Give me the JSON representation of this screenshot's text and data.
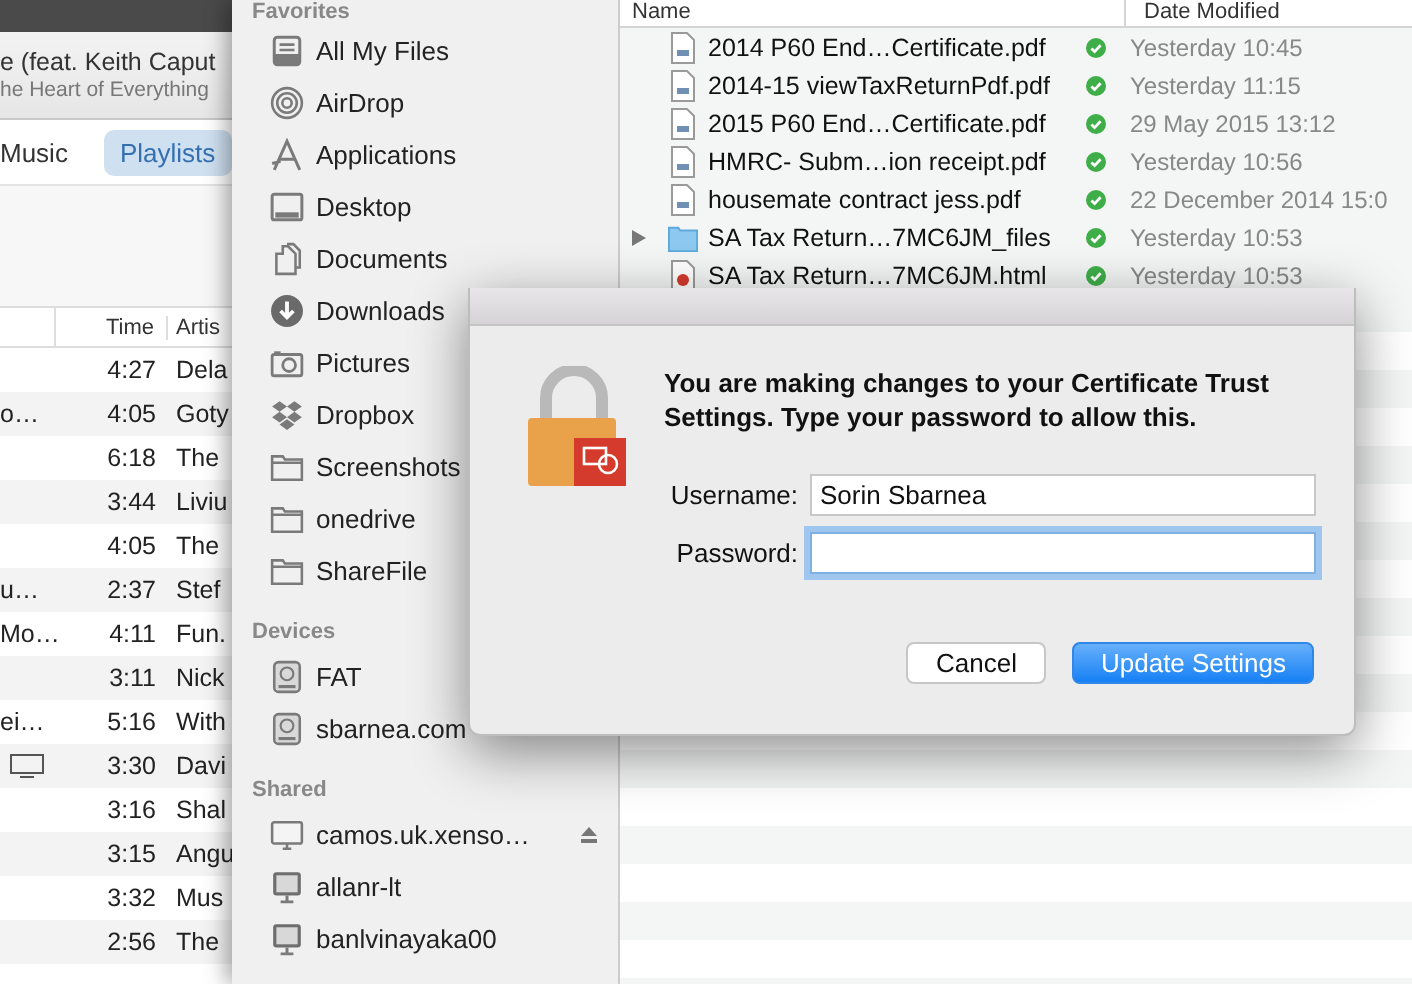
{
  "itunes": {
    "now_playing": {
      "title": "e (feat. Keith Caput",
      "album": "he Heart of Everything"
    },
    "tabs": [
      {
        "label": "Music",
        "selected": false
      },
      {
        "label": "Playlists",
        "selected": true
      }
    ],
    "columns": {
      "time": "Time",
      "artist": "Artis"
    },
    "rows": [
      {
        "kind": "song",
        "time": "4:27",
        "artist": "Dela"
      },
      {
        "kind": "song",
        "name": "o…",
        "time": "4:05",
        "artist": "Goty"
      },
      {
        "kind": "song",
        "time": "6:18",
        "artist": "The"
      },
      {
        "kind": "song",
        "time": "3:44",
        "artist": "Liviu"
      },
      {
        "kind": "song",
        "time": "4:05",
        "artist": "The"
      },
      {
        "kind": "song",
        "name": "u…",
        "time": "2:37",
        "artist": "Stef"
      },
      {
        "kind": "song",
        "name": "Mo…",
        "time": "4:11",
        "artist": "Fun."
      },
      {
        "kind": "song",
        "time": "3:11",
        "artist": "Nick"
      },
      {
        "kind": "song",
        "name": "ei…",
        "time": "5:16",
        "artist": "With"
      },
      {
        "kind": "video",
        "time": "3:30",
        "artist": "Davi"
      },
      {
        "kind": "song",
        "time": "3:16",
        "artist": "Shal"
      },
      {
        "kind": "song",
        "time": "3:15",
        "artist": "Angu"
      },
      {
        "kind": "song",
        "time": "3:32",
        "artist": "Mus"
      },
      {
        "kind": "song",
        "time": "2:56",
        "artist": "The"
      }
    ]
  },
  "finder": {
    "sidebar": [
      {
        "heading": "Favorites",
        "items": [
          {
            "label": "All My Files",
            "kind": "files"
          },
          {
            "label": "AirDrop",
            "kind": "airdrop"
          },
          {
            "label": "Applications",
            "kind": "apps"
          },
          {
            "label": "Desktop",
            "kind": "desktop"
          },
          {
            "label": "Documents",
            "kind": "documents"
          },
          {
            "label": "Downloads",
            "kind": "downloads"
          },
          {
            "label": "Pictures",
            "kind": "pictures"
          },
          {
            "label": "Dropbox",
            "kind": "dropbox"
          },
          {
            "label": "Screenshots",
            "kind": "folder"
          },
          {
            "label": "onedrive",
            "kind": "folder"
          },
          {
            "label": "ShareFile",
            "kind": "folder"
          }
        ]
      },
      {
        "heading": "Devices",
        "items": [
          {
            "label": "FAT",
            "kind": "disk"
          },
          {
            "label": "sbarnea.com",
            "kind": "disk"
          }
        ]
      },
      {
        "heading": "Shared",
        "items": [
          {
            "label": "camos.uk.xenso…",
            "kind": "server",
            "ejectable": true
          },
          {
            "label": "allanr-lt",
            "kind": "computer",
            "ejectable": false
          },
          {
            "label": "banlvinayaka00",
            "kind": "computer",
            "ejectable": false
          }
        ]
      }
    ],
    "columns": {
      "name": "Name",
      "date": "Date Modified"
    },
    "files": [
      {
        "name": "2014 P60 End…Certificate.pdf",
        "kind": "pdf",
        "synced": true,
        "date": "Yesterday 10:45"
      },
      {
        "name": "2014-15 viewTaxReturnPdf.pdf",
        "kind": "pdf",
        "synced": true,
        "date": "Yesterday 11:15"
      },
      {
        "name": "2015 P60 End…Certificate.pdf",
        "kind": "pdf",
        "synced": true,
        "date": "29 May 2015 13:12"
      },
      {
        "name": "HMRC- Subm…ion receipt.pdf",
        "kind": "pdf",
        "synced": true,
        "date": "Yesterday 10:56"
      },
      {
        "name": "housemate contract jess.pdf",
        "kind": "pdf",
        "synced": true,
        "date": "22 December 2014 15:0"
      },
      {
        "name": "SA Tax Return…7MC6JM_files",
        "kind": "folder",
        "synced": true,
        "date": "Yesterday 10:53"
      },
      {
        "name": "SA Tax Return…7MC6JM.html",
        "kind": "html",
        "synced": true,
        "date": "Yesterday 10:53"
      }
    ]
  },
  "dialog": {
    "message": "You are making changes to your Certificate Trust Settings. Type your password to allow this.",
    "fields": [
      {
        "label": "Username:",
        "value": "Sorin Sbarnea",
        "focused": false
      },
      {
        "label": "Password:",
        "focused": true
      }
    ],
    "buttons": [
      {
        "label": "Cancel",
        "default": false
      },
      {
        "label": "Update Settings",
        "default": true
      }
    ]
  }
}
